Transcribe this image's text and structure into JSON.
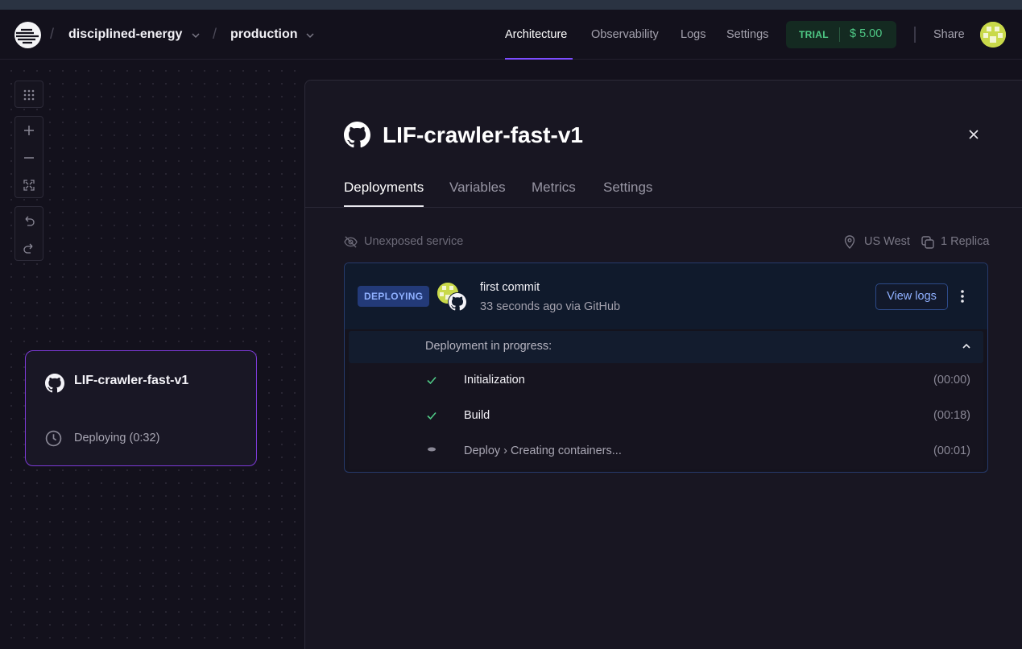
{
  "header": {
    "project": "disciplined-energy",
    "environment": "production",
    "nav": [
      {
        "label": "Architecture",
        "active": true
      },
      {
        "label": "Observability",
        "active": false
      },
      {
        "label": "Logs",
        "active": false
      },
      {
        "label": "Settings",
        "active": false
      }
    ],
    "trial_label": "TRIAL",
    "trial_amount": "$ 5.00",
    "share_label": "Share"
  },
  "canvas": {
    "tools": [
      "grid-icon",
      "zoom-in-icon",
      "zoom-out-icon",
      "fit-screen-icon",
      "undo-icon",
      "redo-icon"
    ],
    "service_card": {
      "name": "LIF-crawler-fast-v1",
      "status": "Deploying (0:32)"
    }
  },
  "panel": {
    "title": "LIF-crawler-fast-v1",
    "tabs": [
      "Deployments",
      "Variables",
      "Metrics",
      "Settings"
    ],
    "active_tab": "Deployments",
    "exposure": "Unexposed service",
    "region": "US West",
    "replicas": "1 Replica",
    "deployment": {
      "badge": "DEPLOYING",
      "commit_message": "first commit",
      "commit_meta": "33 seconds ago via GitHub",
      "view_logs_label": "View logs",
      "progress_label": "Deployment in progress:",
      "steps": [
        {
          "name": "Initialization",
          "time": "(00:00)",
          "state": "done"
        },
        {
          "name": "Build",
          "time": "(00:18)",
          "state": "done"
        },
        {
          "name": "Deploy › Creating containers...",
          "time": "(00:01)",
          "state": "running"
        }
      ]
    }
  },
  "colors": {
    "accent": "#7c4dff",
    "success": "#4fc986",
    "deploying_badge": "#233a78",
    "background": "#13111c"
  }
}
